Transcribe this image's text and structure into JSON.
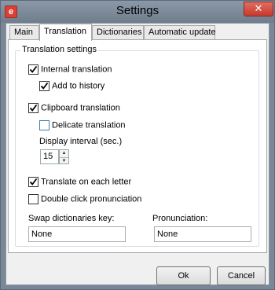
{
  "window": {
    "title": "Settings",
    "icon_glyph": "e",
    "close_glyph": "✕"
  },
  "tabs": [
    {
      "label": "Main"
    },
    {
      "label": "Translation"
    },
    {
      "label": "Dictionaries"
    },
    {
      "label": "Automatic update"
    }
  ],
  "active_tab": "Translation",
  "group": {
    "title": "Translation settings",
    "internal_translation": {
      "label": "Internal translation",
      "checked": true
    },
    "add_to_history": {
      "label": "Add to history",
      "checked": true
    },
    "clipboard_translation": {
      "label": "Clipboard translation",
      "checked": true
    },
    "delicate_translation": {
      "label": "Delicate translation",
      "checked": false
    },
    "display_interval": {
      "label": "Display interval (sec.)",
      "value": "15",
      "up": "▲",
      "down": "▼"
    },
    "translate_each_letter": {
      "label": "Translate on each letter",
      "checked": true
    },
    "double_click_pronunciation": {
      "label": "Double click pronunciation",
      "checked": false
    },
    "swap_key": {
      "label": "Swap dictionaries key:",
      "value": "None"
    },
    "pronunciation": {
      "label": "Pronunciation:",
      "value": "None"
    }
  },
  "buttons": {
    "ok": "Ok",
    "cancel": "Cancel"
  },
  "colors": {
    "titlebar": "#7a8796",
    "close": "#c7392d",
    "check": "#000000"
  }
}
